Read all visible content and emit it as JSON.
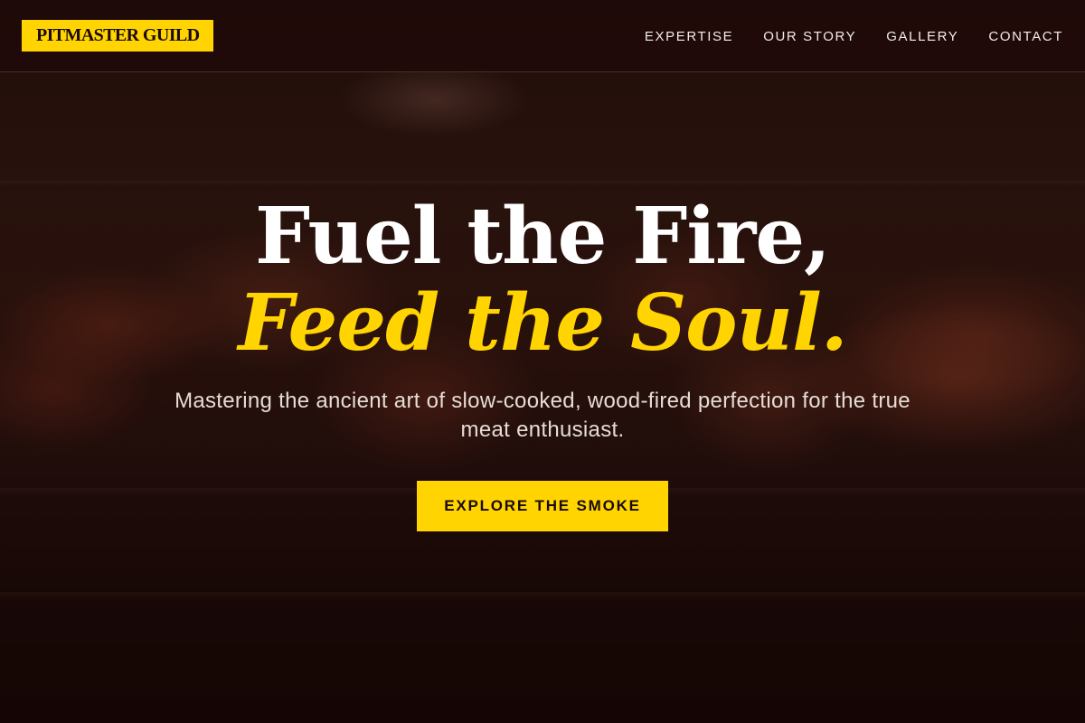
{
  "header": {
    "logo_text": "PITMASTER GUILD",
    "nav": [
      {
        "label": "EXPERTISE"
      },
      {
        "label": "OUR STORY"
      },
      {
        "label": "GALLERY"
      },
      {
        "label": "CONTACT"
      }
    ]
  },
  "hero": {
    "headline_line1": "Fuel the Fire,",
    "headline_line2": "Feed the Soul.",
    "subtitle": "Mastering the ancient art of slow-cooked, wood-fired perfection for the true meat enthusiast.",
    "cta_label": "EXPLORE THE SMOKE"
  },
  "colors": {
    "accent": "#ffd400",
    "background": "#1a0a08",
    "text_light": "#ffffff"
  }
}
